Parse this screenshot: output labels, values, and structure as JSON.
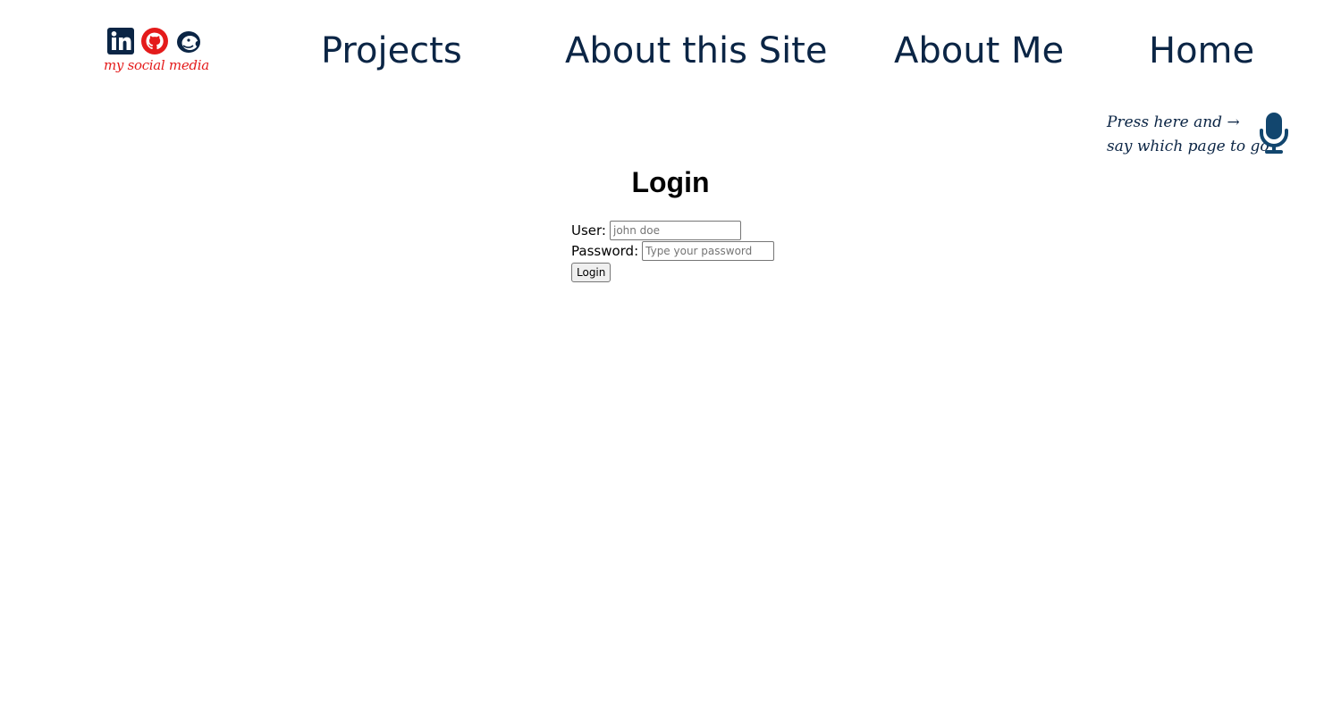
{
  "social": {
    "caption": "my social media",
    "icons": [
      "linkedin-icon",
      "github-icon",
      "mailchimp-icon"
    ],
    "colors": {
      "linkedin": "#0b2545",
      "github": "#e41b1b",
      "mailchimp": "#0b2545"
    }
  },
  "nav": {
    "projects": "Projects",
    "about_site": "About this Site",
    "about_me": "About Me",
    "home": "Home",
    "color": "#0b2545"
  },
  "voice": {
    "line1": "Press here and →",
    "line2": "say which page to go",
    "icon": "microphone-icon"
  },
  "login": {
    "title": "Login",
    "user_label": "User:",
    "user_placeholder": "john doe",
    "user_value": "",
    "password_label": "Password:",
    "password_placeholder": "Type your password",
    "password_value": "",
    "button_label": "Login"
  }
}
